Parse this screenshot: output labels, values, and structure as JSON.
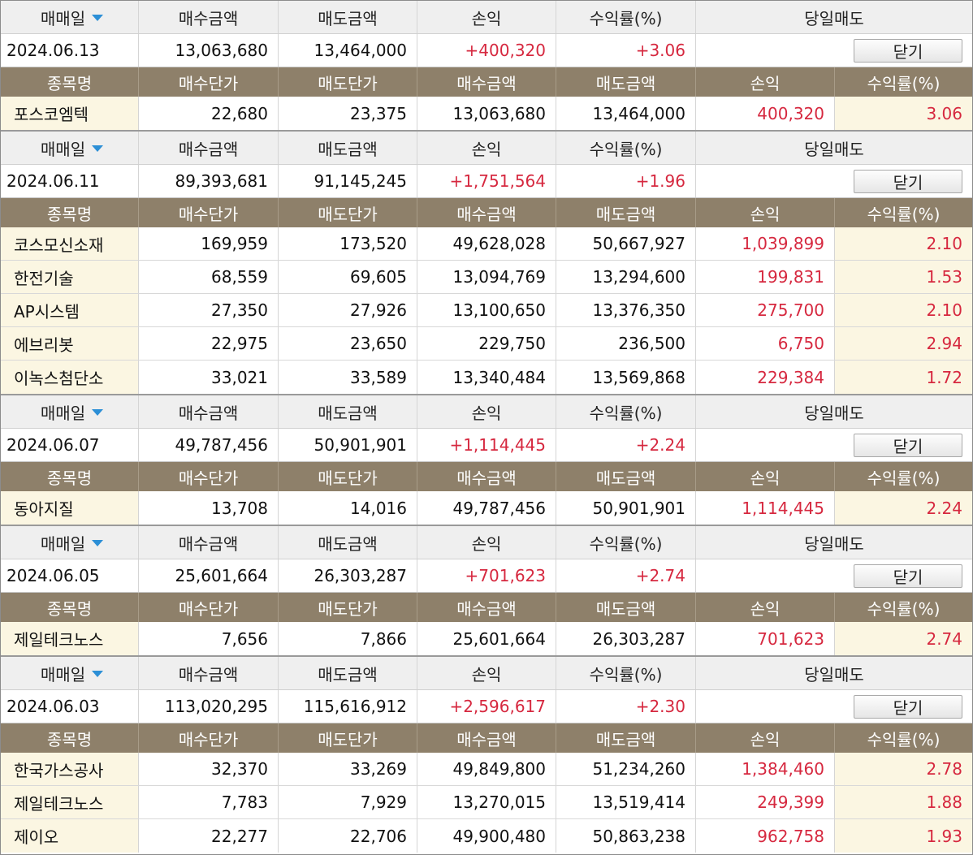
{
  "labels": {
    "trade_date": "매매일",
    "buy_amount": "매수금액",
    "sell_amount": "매도금액",
    "pnl": "손익",
    "return_rate": "수익률(%)",
    "same_day_sell": "당일매도",
    "close_button": "닫기",
    "stock_name": "종목명",
    "buy_price": "매수단가",
    "sell_price": "매도단가"
  },
  "colors": {
    "header_bg": "#efefef",
    "sub_header_bg": "#8e806a",
    "name_cell_bg": "#fbf6e2",
    "positive": "#d6283f",
    "sort_arrow": "#2c8fd6"
  },
  "sort_icon": "sort-down-triangle-icon",
  "groups": [
    {
      "date": "2024.06.13",
      "buy_amount": "13,063,680",
      "sell_amount": "13,464,000",
      "pnl": "+400,320",
      "rate": "+3.06",
      "items": [
        {
          "name": "포스코엠텍",
          "buy_price": "22,680",
          "sell_price": "23,375",
          "buy_amount": "13,063,680",
          "sell_amount": "13,464,000",
          "pnl": "400,320",
          "rate": "3.06"
        }
      ]
    },
    {
      "date": "2024.06.11",
      "buy_amount": "89,393,681",
      "sell_amount": "91,145,245",
      "pnl": "+1,751,564",
      "rate": "+1.96",
      "items": [
        {
          "name": "코스모신소재",
          "buy_price": "169,959",
          "sell_price": "173,520",
          "buy_amount": "49,628,028",
          "sell_amount": "50,667,927",
          "pnl": "1,039,899",
          "rate": "2.10"
        },
        {
          "name": "한전기술",
          "buy_price": "68,559",
          "sell_price": "69,605",
          "buy_amount": "13,094,769",
          "sell_amount": "13,294,600",
          "pnl": "199,831",
          "rate": "1.53"
        },
        {
          "name": "AP시스템",
          "buy_price": "27,350",
          "sell_price": "27,926",
          "buy_amount": "13,100,650",
          "sell_amount": "13,376,350",
          "pnl": "275,700",
          "rate": "2.10"
        },
        {
          "name": "에브리봇",
          "buy_price": "22,975",
          "sell_price": "23,650",
          "buy_amount": "229,750",
          "sell_amount": "236,500",
          "pnl": "6,750",
          "rate": "2.94"
        },
        {
          "name": "이녹스첨단소",
          "buy_price": "33,021",
          "sell_price": "33,589",
          "buy_amount": "13,340,484",
          "sell_amount": "13,569,868",
          "pnl": "229,384",
          "rate": "1.72"
        }
      ]
    },
    {
      "date": "2024.06.07",
      "buy_amount": "49,787,456",
      "sell_amount": "50,901,901",
      "pnl": "+1,114,445",
      "rate": "+2.24",
      "items": [
        {
          "name": "동아지질",
          "buy_price": "13,708",
          "sell_price": "14,016",
          "buy_amount": "49,787,456",
          "sell_amount": "50,901,901",
          "pnl": "1,114,445",
          "rate": "2.24"
        }
      ]
    },
    {
      "date": "2024.06.05",
      "buy_amount": "25,601,664",
      "sell_amount": "26,303,287",
      "pnl": "+701,623",
      "rate": "+2.74",
      "items": [
        {
          "name": "제일테크노스",
          "buy_price": "7,656",
          "sell_price": "7,866",
          "buy_amount": "25,601,664",
          "sell_amount": "26,303,287",
          "pnl": "701,623",
          "rate": "2.74"
        }
      ]
    },
    {
      "date": "2024.06.03",
      "buy_amount": "113,020,295",
      "sell_amount": "115,616,912",
      "pnl": "+2,596,617",
      "rate": "+2.30",
      "items": [
        {
          "name": "한국가스공사",
          "buy_price": "32,370",
          "sell_price": "33,269",
          "buy_amount": "49,849,800",
          "sell_amount": "51,234,260",
          "pnl": "1,384,460",
          "rate": "2.78"
        },
        {
          "name": "제일테크노스",
          "buy_price": "7,783",
          "sell_price": "7,929",
          "buy_amount": "13,270,015",
          "sell_amount": "13,519,414",
          "pnl": "249,399",
          "rate": "1.88"
        },
        {
          "name": "제이오",
          "buy_price": "22,277",
          "sell_price": "22,706",
          "buy_amount": "49,900,480",
          "sell_amount": "50,863,238",
          "pnl": "962,758",
          "rate": "1.93"
        }
      ]
    }
  ]
}
